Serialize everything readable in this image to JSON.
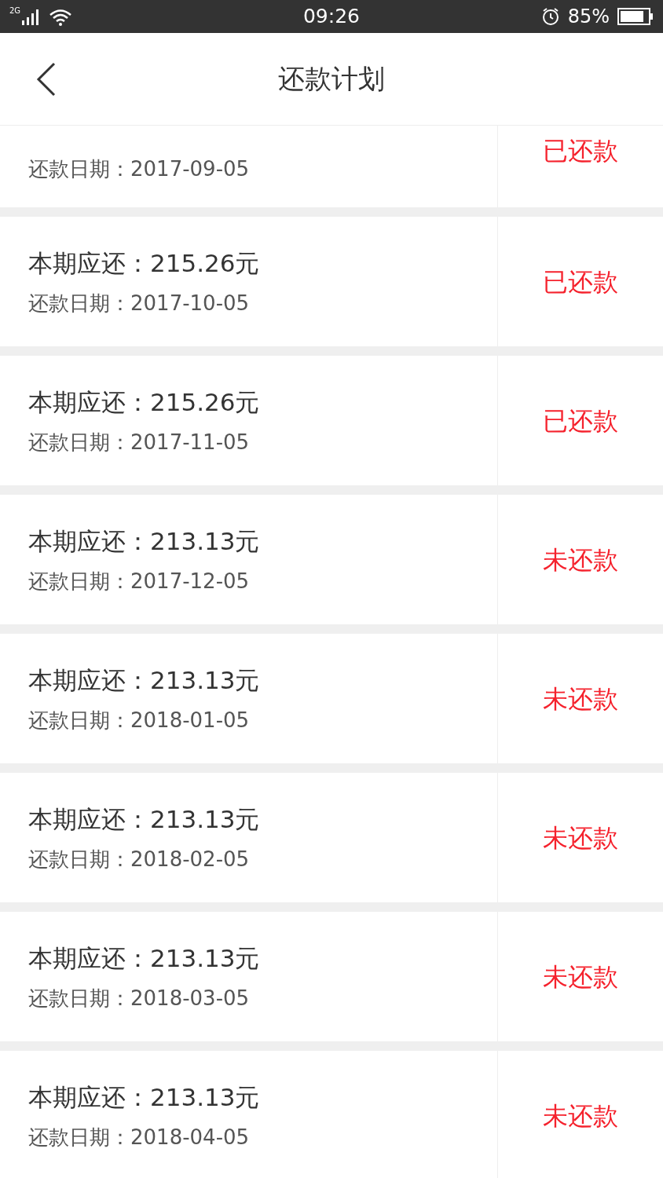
{
  "status_bar": {
    "network": "2G",
    "time": "09:26",
    "battery": "85%"
  },
  "header": {
    "title": "还款计划"
  },
  "plans": [
    {
      "date_label": "还款日期：",
      "date": "2017-09-05",
      "status": "已还款"
    },
    {
      "amount": "本期应还：215.26元",
      "date_label": "还款日期：",
      "date": "2017-10-05",
      "status": "已还款"
    },
    {
      "amount": "本期应还：215.26元",
      "date_label": "还款日期：",
      "date": "2017-11-05",
      "status": "已还款"
    },
    {
      "amount": "本期应还：213.13元",
      "date_label": "还款日期：",
      "date": "2017-12-05",
      "status": "未还款"
    },
    {
      "amount": "本期应还：213.13元",
      "date_label": "还款日期：",
      "date": "2018-01-05",
      "status": "未还款"
    },
    {
      "amount": "本期应还：213.13元",
      "date_label": "还款日期：",
      "date": "2018-02-05",
      "status": "未还款"
    },
    {
      "amount": "本期应还：213.13元",
      "date_label": "还款日期：",
      "date": "2018-03-05",
      "status": "未还款"
    },
    {
      "amount": "本期应还：213.13元",
      "date_label": "还款日期：",
      "date": "2018-04-05",
      "status": "未还款"
    }
  ]
}
